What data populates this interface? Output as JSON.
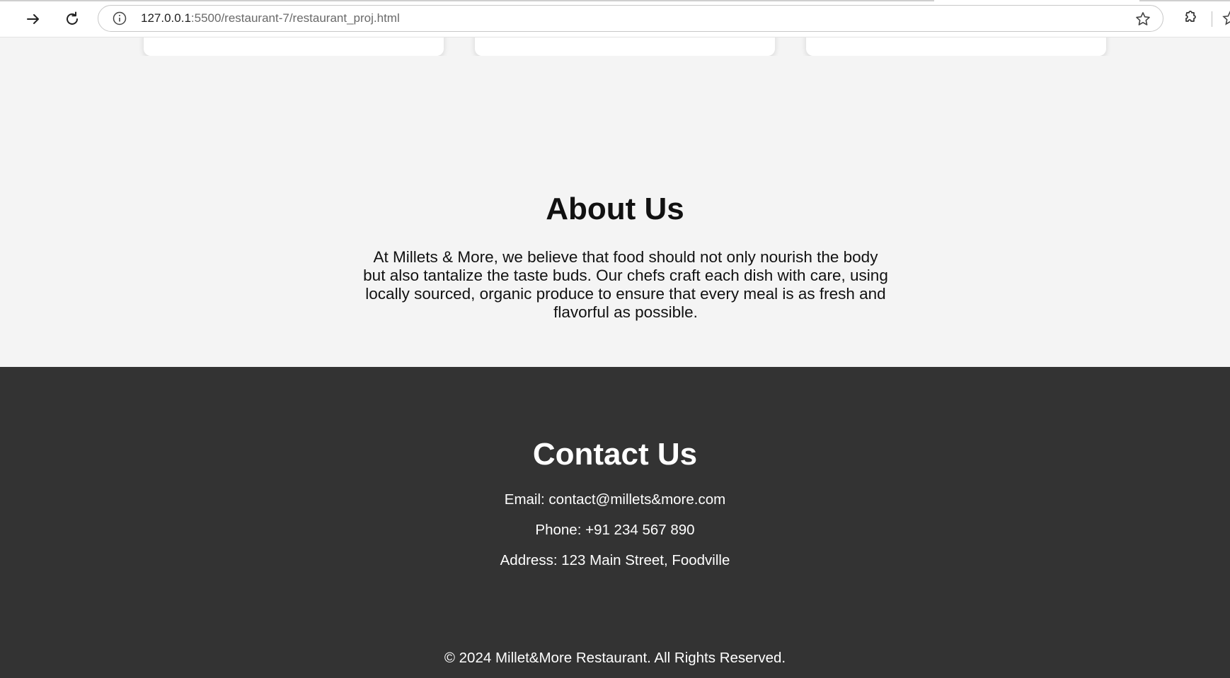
{
  "browser": {
    "url_host": "127.0.0.1",
    "url_path": ":5500/restaurant-7/restaurant_proj.html",
    "icons": [
      "forward-icon",
      "reload-icon",
      "info-icon",
      "star-icon",
      "extensions-icon"
    ]
  },
  "about": {
    "title": "About Us",
    "text": "At Millets & More, we believe that food should not only nourish the body but also tantalize the taste buds. Our chefs craft each dish with care, using locally sourced, organic produce to ensure that every meal is as fresh and flavorful as possible."
  },
  "contact": {
    "title": "Contact Us",
    "email": "Email: contact@millets&more.com",
    "phone": "Phone: +91 234 567 890",
    "address": "Address: 123 Main Street, Foodville",
    "copyright": "© 2024 Millet&More Restaurant. All Rights Reserved."
  },
  "colors": {
    "page_bg": "#f4f4f4",
    "footer_bg": "#333333",
    "heading_text": "#111111",
    "footer_text": "#ffffff"
  }
}
